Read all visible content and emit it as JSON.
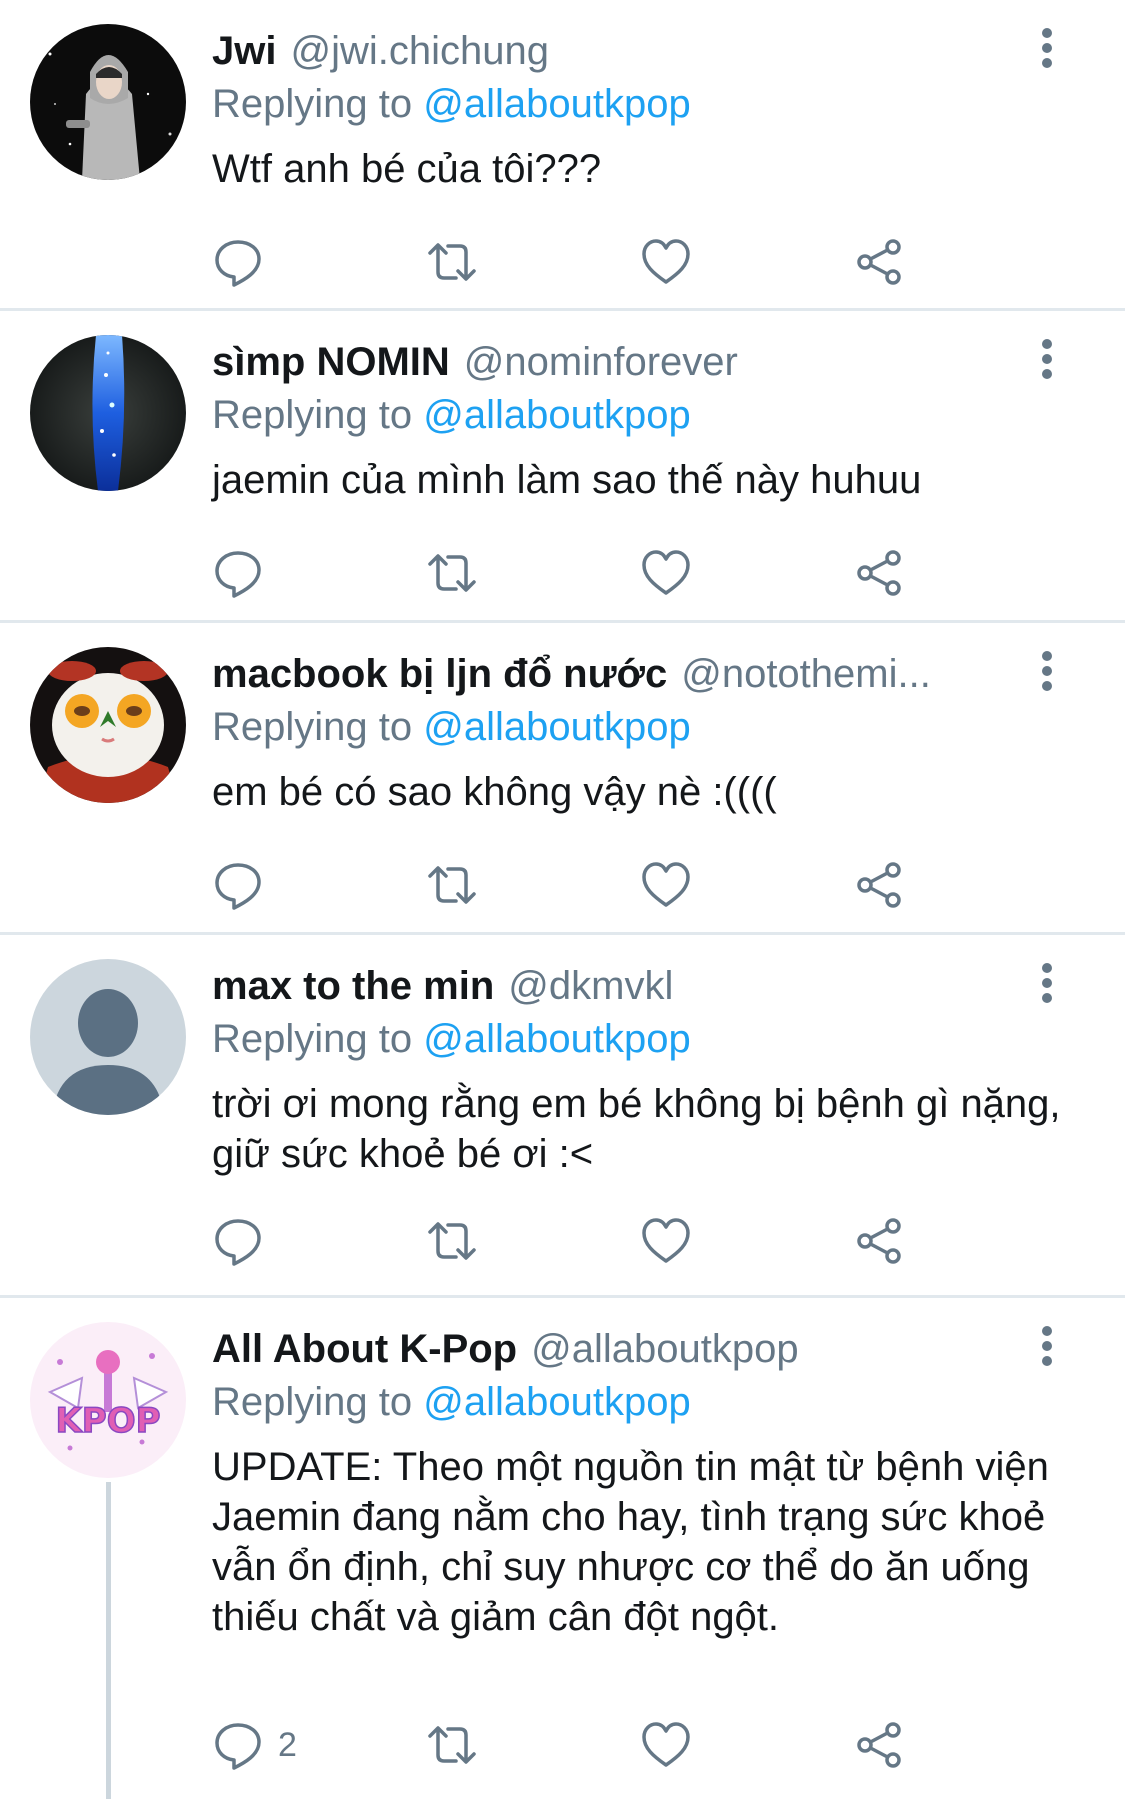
{
  "replying_prefix": "Replying to ",
  "tweets": [
    {
      "name": "Jwi",
      "handle": "@jwi.chichung",
      "reply_to": "@allaboutkpop",
      "text": "Wtf anh bé của tôi???",
      "reply_count": ""
    },
    {
      "name": "sìmp NOMIN",
      "handle": "@nominforever",
      "reply_to": "@allaboutkpop",
      "text": "jaemin của mình làm sao thế này huhuu",
      "reply_count": ""
    },
    {
      "name": "macbook bị ljn đổ nước",
      "handle": "@notothemi...",
      "reply_to": "@allaboutkpop",
      "text": "em bé có sao không vậy nè :((((",
      "reply_count": ""
    },
    {
      "name": "max to the min",
      "handle": "@dkmvkl",
      "reply_to": "@allaboutkpop",
      "text": "trời ơi mong rằng em bé không bị bệnh gì nặng, giữ sức khoẻ bé ơi :<",
      "reply_count": ""
    },
    {
      "name": "All About K-Pop",
      "handle": "@allaboutkpop",
      "reply_to": "@allaboutkpop",
      "text": "UPDATE: Theo một nguồn tin mật từ bệnh viện Jaemin đang nằm cho hay, tình trạng sức khoẻ vẫn ổn định, chỉ suy nhược cơ thể do ăn uống thiếu chất và giảm cân đột ngột.",
      "reply_count": "2",
      "avatar_logo_text": "KPOP"
    }
  ],
  "icons": {
    "reply": "reply-bubble-icon",
    "retweet": "retweet-icon",
    "like": "heart-icon",
    "share": "share-icon",
    "more": "more-vertical-icon"
  },
  "colors": {
    "link": "#1da1f2",
    "secondary_text": "#657786",
    "icon": "#657786",
    "divider": "#e1e8ed",
    "placeholder_avatar_bg": "#ccd6dd",
    "placeholder_avatar_fg": "#5b7083"
  }
}
